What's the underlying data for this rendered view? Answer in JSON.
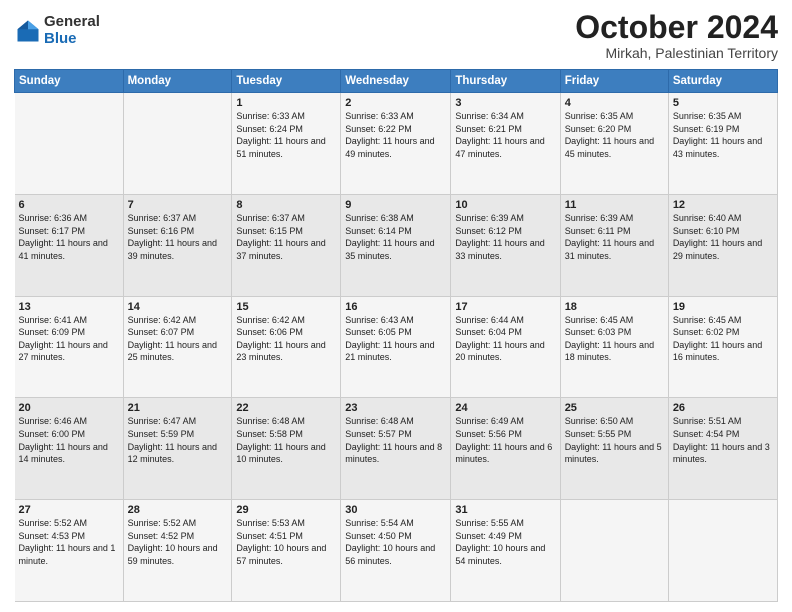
{
  "logo": {
    "general": "General",
    "blue": "Blue",
    "icon_color": "#1a6bb5"
  },
  "title": "October 2024",
  "subtitle": "Mirkah, Palestinian Territory",
  "header_days": [
    "Sunday",
    "Monday",
    "Tuesday",
    "Wednesday",
    "Thursday",
    "Friday",
    "Saturday"
  ],
  "weeks": [
    [
      {
        "day": "",
        "info": ""
      },
      {
        "day": "",
        "info": ""
      },
      {
        "day": "1",
        "info": "Sunrise: 6:33 AM\nSunset: 6:24 PM\nDaylight: 11 hours and 51 minutes."
      },
      {
        "day": "2",
        "info": "Sunrise: 6:33 AM\nSunset: 6:22 PM\nDaylight: 11 hours and 49 minutes."
      },
      {
        "day": "3",
        "info": "Sunrise: 6:34 AM\nSunset: 6:21 PM\nDaylight: 11 hours and 47 minutes."
      },
      {
        "day": "4",
        "info": "Sunrise: 6:35 AM\nSunset: 6:20 PM\nDaylight: 11 hours and 45 minutes."
      },
      {
        "day": "5",
        "info": "Sunrise: 6:35 AM\nSunset: 6:19 PM\nDaylight: 11 hours and 43 minutes."
      }
    ],
    [
      {
        "day": "6",
        "info": "Sunrise: 6:36 AM\nSunset: 6:17 PM\nDaylight: 11 hours and 41 minutes."
      },
      {
        "day": "7",
        "info": "Sunrise: 6:37 AM\nSunset: 6:16 PM\nDaylight: 11 hours and 39 minutes."
      },
      {
        "day": "8",
        "info": "Sunrise: 6:37 AM\nSunset: 6:15 PM\nDaylight: 11 hours and 37 minutes."
      },
      {
        "day": "9",
        "info": "Sunrise: 6:38 AM\nSunset: 6:14 PM\nDaylight: 11 hours and 35 minutes."
      },
      {
        "day": "10",
        "info": "Sunrise: 6:39 AM\nSunset: 6:12 PM\nDaylight: 11 hours and 33 minutes."
      },
      {
        "day": "11",
        "info": "Sunrise: 6:39 AM\nSunset: 6:11 PM\nDaylight: 11 hours and 31 minutes."
      },
      {
        "day": "12",
        "info": "Sunrise: 6:40 AM\nSunset: 6:10 PM\nDaylight: 11 hours and 29 minutes."
      }
    ],
    [
      {
        "day": "13",
        "info": "Sunrise: 6:41 AM\nSunset: 6:09 PM\nDaylight: 11 hours and 27 minutes."
      },
      {
        "day": "14",
        "info": "Sunrise: 6:42 AM\nSunset: 6:07 PM\nDaylight: 11 hours and 25 minutes."
      },
      {
        "day": "15",
        "info": "Sunrise: 6:42 AM\nSunset: 6:06 PM\nDaylight: 11 hours and 23 minutes."
      },
      {
        "day": "16",
        "info": "Sunrise: 6:43 AM\nSunset: 6:05 PM\nDaylight: 11 hours and 21 minutes."
      },
      {
        "day": "17",
        "info": "Sunrise: 6:44 AM\nSunset: 6:04 PM\nDaylight: 11 hours and 20 minutes."
      },
      {
        "day": "18",
        "info": "Sunrise: 6:45 AM\nSunset: 6:03 PM\nDaylight: 11 hours and 18 minutes."
      },
      {
        "day": "19",
        "info": "Sunrise: 6:45 AM\nSunset: 6:02 PM\nDaylight: 11 hours and 16 minutes."
      }
    ],
    [
      {
        "day": "20",
        "info": "Sunrise: 6:46 AM\nSunset: 6:00 PM\nDaylight: 11 hours and 14 minutes."
      },
      {
        "day": "21",
        "info": "Sunrise: 6:47 AM\nSunset: 5:59 PM\nDaylight: 11 hours and 12 minutes."
      },
      {
        "day": "22",
        "info": "Sunrise: 6:48 AM\nSunset: 5:58 PM\nDaylight: 11 hours and 10 minutes."
      },
      {
        "day": "23",
        "info": "Sunrise: 6:48 AM\nSunset: 5:57 PM\nDaylight: 11 hours and 8 minutes."
      },
      {
        "day": "24",
        "info": "Sunrise: 6:49 AM\nSunset: 5:56 PM\nDaylight: 11 hours and 6 minutes."
      },
      {
        "day": "25",
        "info": "Sunrise: 6:50 AM\nSunset: 5:55 PM\nDaylight: 11 hours and 5 minutes."
      },
      {
        "day": "26",
        "info": "Sunrise: 5:51 AM\nSunset: 4:54 PM\nDaylight: 11 hours and 3 minutes."
      }
    ],
    [
      {
        "day": "27",
        "info": "Sunrise: 5:52 AM\nSunset: 4:53 PM\nDaylight: 11 hours and 1 minute."
      },
      {
        "day": "28",
        "info": "Sunrise: 5:52 AM\nSunset: 4:52 PM\nDaylight: 10 hours and 59 minutes."
      },
      {
        "day": "29",
        "info": "Sunrise: 5:53 AM\nSunset: 4:51 PM\nDaylight: 10 hours and 57 minutes."
      },
      {
        "day": "30",
        "info": "Sunrise: 5:54 AM\nSunset: 4:50 PM\nDaylight: 10 hours and 56 minutes."
      },
      {
        "day": "31",
        "info": "Sunrise: 5:55 AM\nSunset: 4:49 PM\nDaylight: 10 hours and 54 minutes."
      },
      {
        "day": "",
        "info": ""
      },
      {
        "day": "",
        "info": ""
      }
    ]
  ]
}
